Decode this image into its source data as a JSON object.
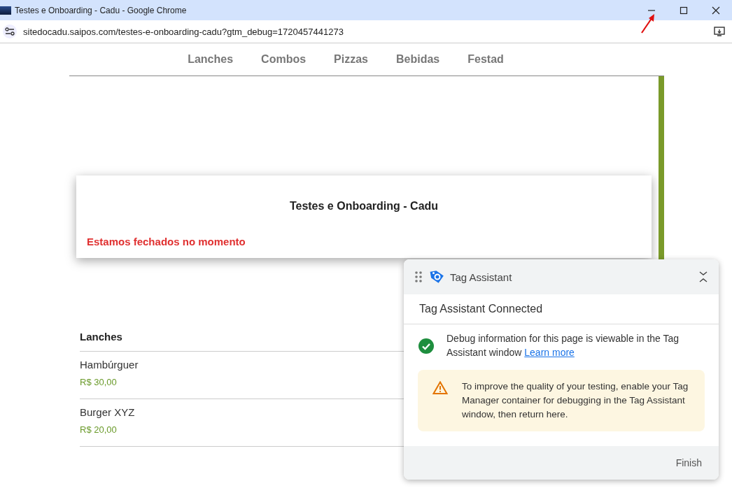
{
  "window": {
    "title": "Testes e Onboarding - Cadu - Google Chrome"
  },
  "address_bar": {
    "url": "sitedocadu.saipos.com/testes-e-onboarding-cadu?gtm_debug=1720457441273"
  },
  "nav": [
    {
      "label": "Lanches"
    },
    {
      "label": "Combos"
    },
    {
      "label": "Pizzas"
    },
    {
      "label": "Bebidas"
    },
    {
      "label": "Festad"
    }
  ],
  "store_card": {
    "title": "Testes e Onboarding - Cadu",
    "status": "Estamos fechados no momento"
  },
  "menu_section": {
    "title": "Lanches",
    "items": [
      {
        "name": "Hambúrguer",
        "price": "R$ 30,00"
      },
      {
        "name": "Burger XYZ",
        "price": "R$ 20,00"
      }
    ]
  },
  "tag_assistant": {
    "title": "Tag Assistant",
    "heading": "Tag Assistant Connected",
    "info": "Debug information for this page is viewable in the Tag Assistant window",
    "link": "Learn more",
    "warning": "To improve the quality of your testing, enable your Tag Manager container for debugging in the Tag Assistant window, then return here.",
    "finish": "Finish"
  }
}
